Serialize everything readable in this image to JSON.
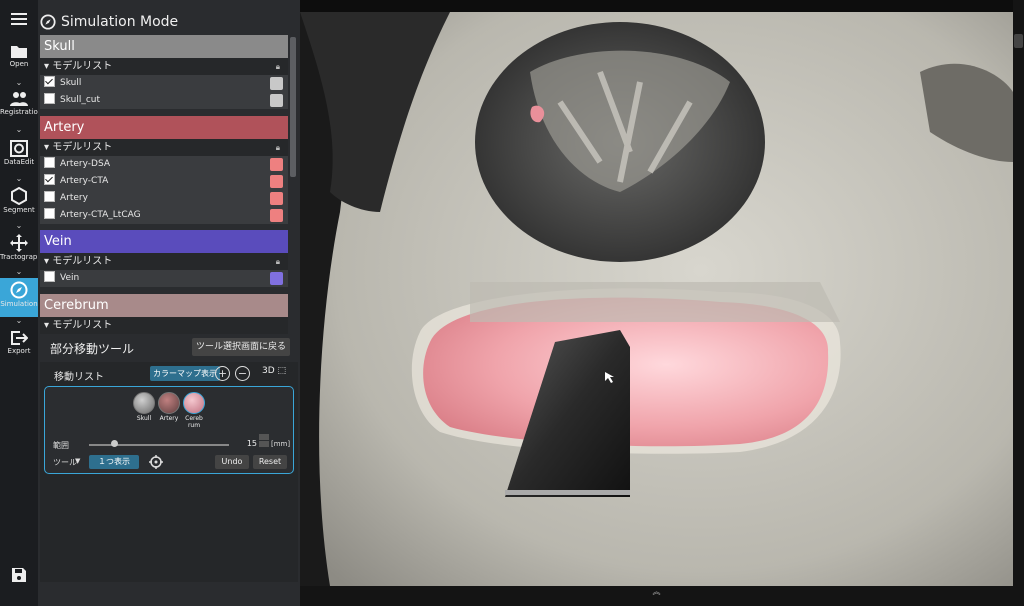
{
  "rail": {
    "items": [
      {
        "label": "Open",
        "icon": "folder-open-icon"
      },
      {
        "label": "Registration",
        "icon": "people-icon"
      },
      {
        "label": "DataEdit",
        "icon": "data-edit-icon"
      },
      {
        "label": "Segment",
        "icon": "hexagon-icon"
      },
      {
        "label": "Tractography",
        "icon": "move-arrows-icon"
      },
      {
        "label": "Simulation",
        "icon": "compass-icon"
      },
      {
        "label": "Export",
        "icon": "export-icon"
      }
    ],
    "active": "Simulation"
  },
  "panel": {
    "title": "Simulation Mode",
    "groups": [
      {
        "name": "Skull",
        "color": "#8a8a8a",
        "sublist": "モデルリスト",
        "items": [
          {
            "label": "Skull",
            "checked": true,
            "swatch": "#c8c8c8"
          },
          {
            "label": "Skull_cut",
            "checked": false,
            "swatch": "#c8c8c8"
          }
        ]
      },
      {
        "name": "Artery",
        "color": "#b0525a",
        "sublist": "モデルリスト",
        "items": [
          {
            "label": "Artery-DSA",
            "checked": false,
            "swatch": "#ee8080"
          },
          {
            "label": "Artery-CTA",
            "checked": true,
            "swatch": "#ee8080"
          },
          {
            "label": "Artery",
            "checked": false,
            "swatch": "#ee8080"
          },
          {
            "label": "Artery-CTA_LtCAG",
            "checked": false,
            "swatch": "#ee8080"
          }
        ]
      },
      {
        "name": "Vein",
        "color": "#5a4cbc",
        "sublist": "モデルリスト",
        "items": [
          {
            "label": "Vein",
            "checked": false,
            "swatch": "#8070e0"
          }
        ]
      },
      {
        "name": "Cerebrum",
        "color": "#a88a8a",
        "sublist": "モデルリスト",
        "items": []
      }
    ]
  },
  "tool": {
    "title": "部分移動ツール",
    "back_label": "ツール選択画面に戻る",
    "move_list_label": "移動リスト",
    "colormap_label": "カラーマップ表示",
    "plus": "+",
    "minus": "−",
    "mode_3d": "3D",
    "objects": [
      {
        "name": "Skull",
        "color": "#9a9a9a"
      },
      {
        "name": "Artery",
        "color": "#a06060"
      },
      {
        "name": "Cerebrum",
        "color": "#e6a6b0"
      }
    ],
    "range_label": "範囲",
    "range_value": "15",
    "range_unit": "[mm]",
    "range_fraction": 0.18,
    "tool_label": "ツール",
    "tool_dropdown": "▼",
    "show_one_label": "１つ表示",
    "undo_label": "Undo",
    "reset_label": "Reset"
  },
  "viewport": {
    "bottom_toggle": "︽"
  }
}
